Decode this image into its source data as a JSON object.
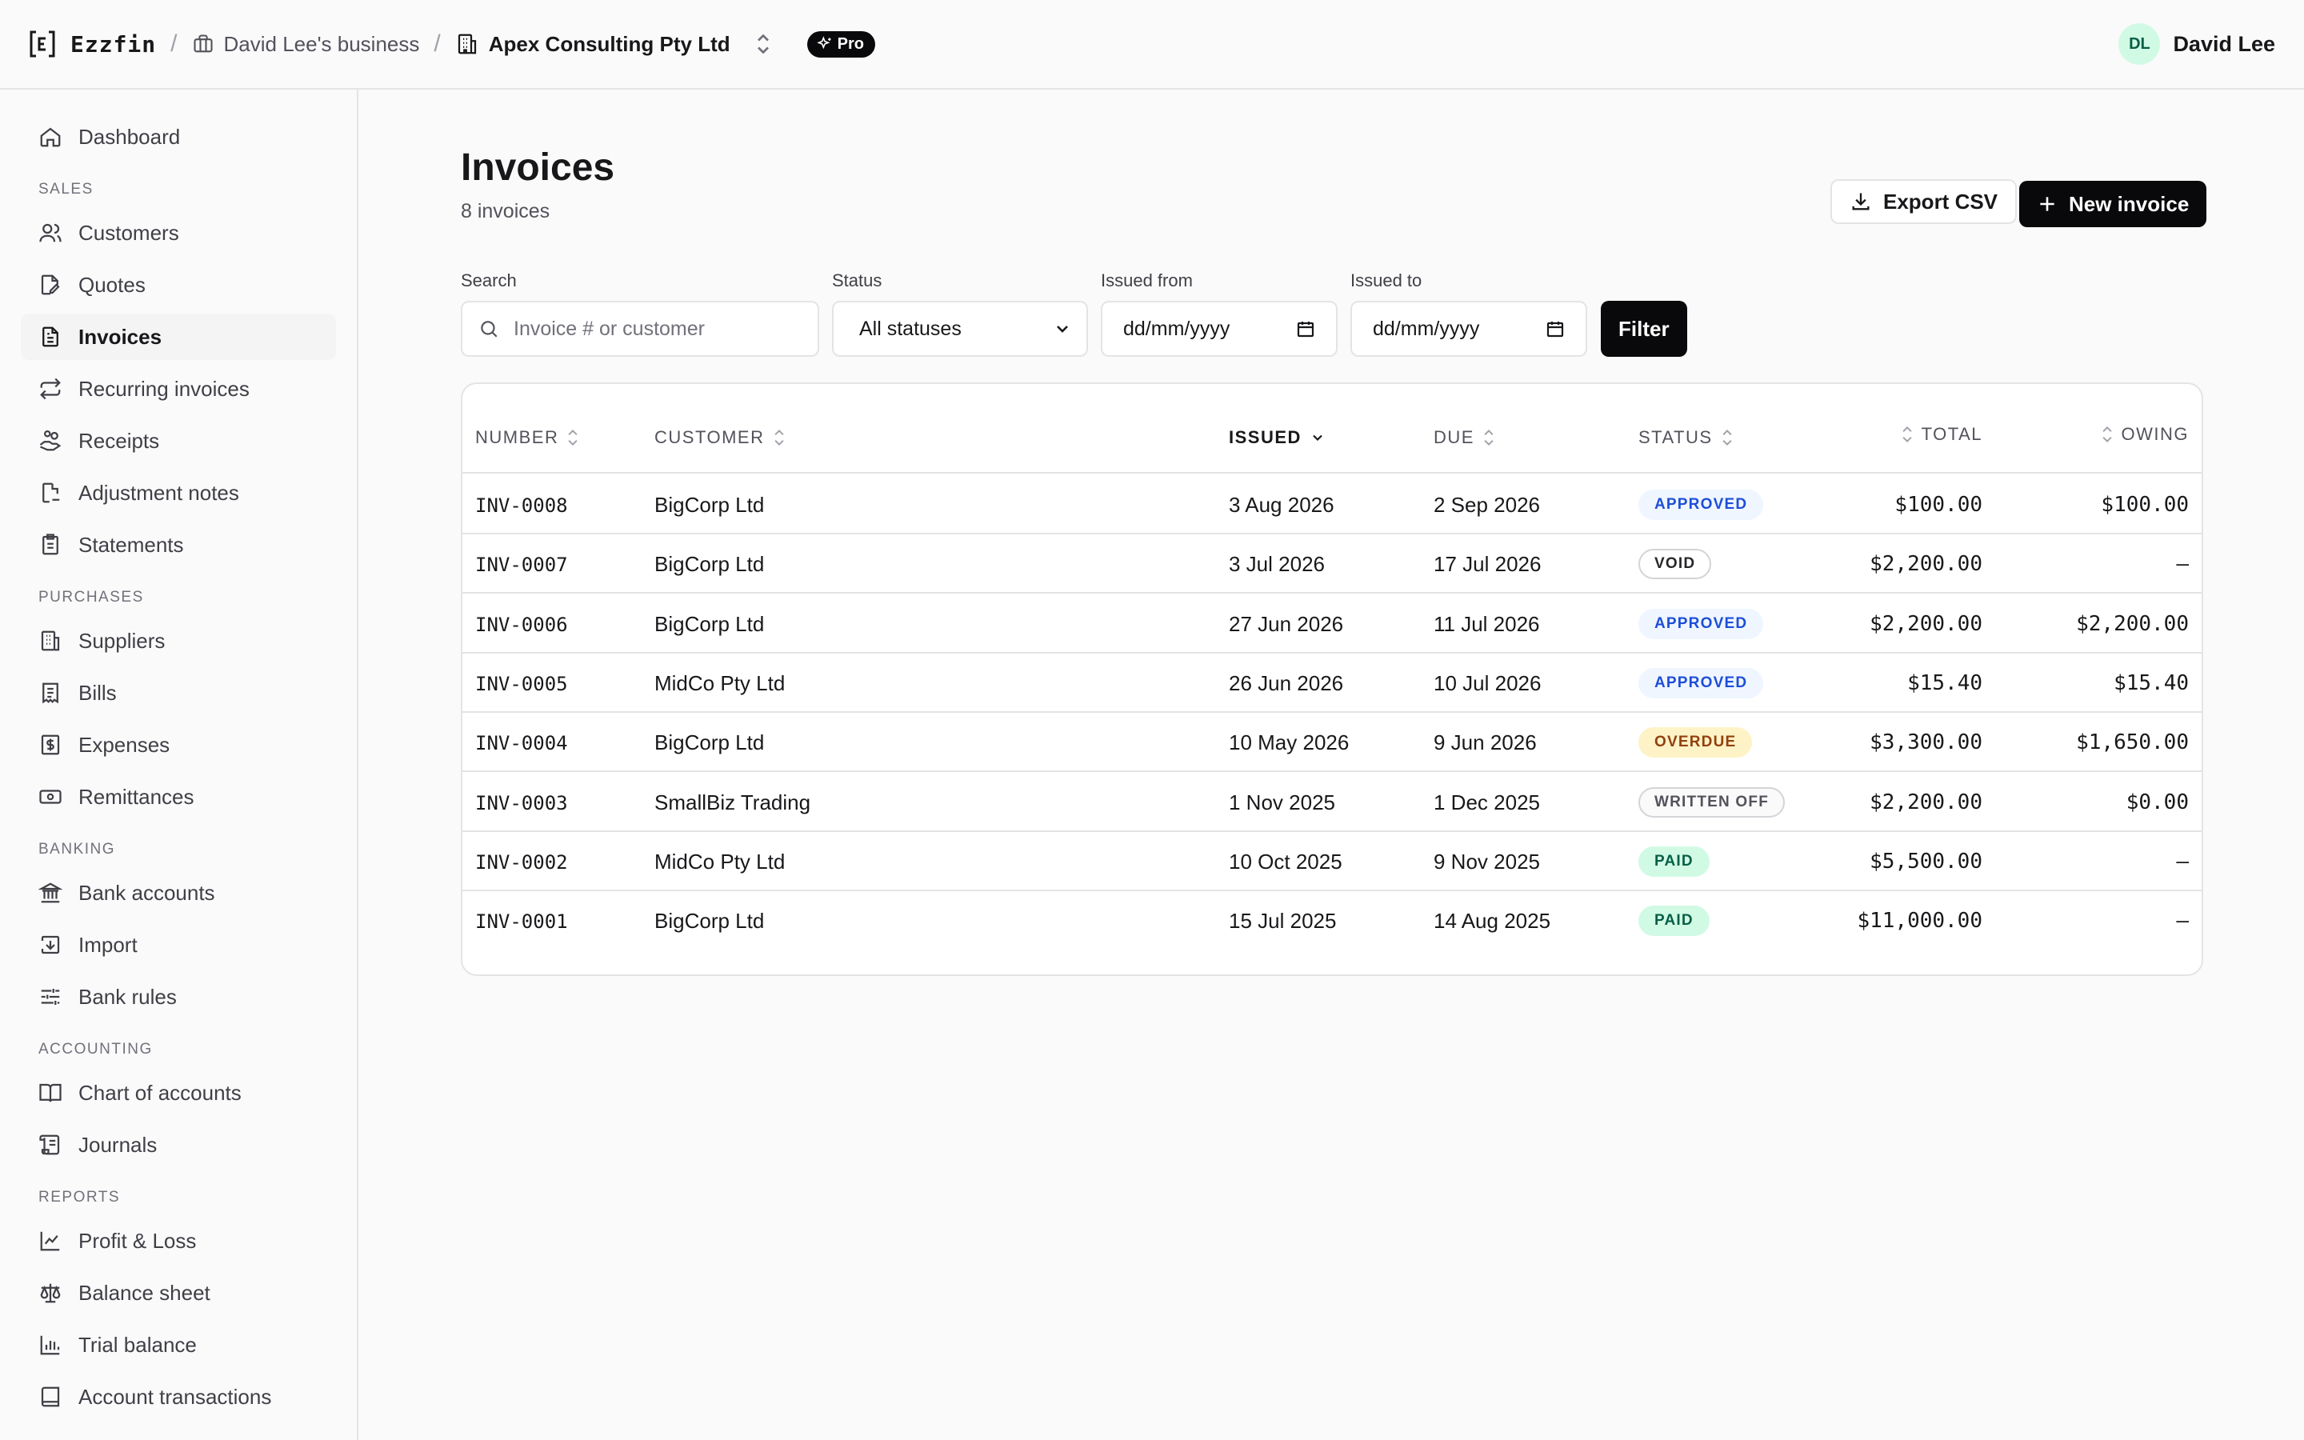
{
  "app": {
    "name": "Ezzfin"
  },
  "breadcrumb": {
    "business": "David Lee's business",
    "org": "Apex Consulting Pty Ltd",
    "plan": "Pro"
  },
  "user": {
    "initials": "DL",
    "name": "David Lee"
  },
  "sidebar": {
    "dashboard": "Dashboard",
    "sections": {
      "sales": "SALES",
      "purchases": "PURCHASES",
      "banking": "BANKING",
      "accounting": "ACCOUNTING",
      "reports": "REPORTS"
    },
    "sales": [
      "Customers",
      "Quotes",
      "Invoices",
      "Recurring invoices",
      "Receipts",
      "Adjustment notes",
      "Statements"
    ],
    "purchases": [
      "Suppliers",
      "Bills",
      "Expenses",
      "Remittances"
    ],
    "banking": [
      "Bank accounts",
      "Import",
      "Bank rules"
    ],
    "accounting": [
      "Chart of accounts",
      "Journals"
    ],
    "reports": [
      "Profit & Loss",
      "Balance sheet",
      "Trial balance",
      "Account transactions"
    ]
  },
  "page": {
    "title": "Invoices",
    "subtitle": "8 invoices",
    "export_label": "Export CSV",
    "new_label": "New invoice"
  },
  "filters": {
    "search_label": "Search",
    "search_placeholder": "Invoice # or customer",
    "status_label": "Status",
    "status_value": "All statuses",
    "from_label": "Issued from",
    "from_value": "dd/mm/yyyy",
    "to_label": "Issued to",
    "to_value": "dd/mm/yyyy",
    "filter_label": "Filter"
  },
  "table": {
    "headers": {
      "number": "NUMBER",
      "customer": "CUSTOMER",
      "issued": "ISSUED",
      "due": "DUE",
      "status": "STATUS",
      "total": "TOTAL",
      "owing": "OWING"
    },
    "rows": [
      {
        "number": "INV-0008",
        "customer": "BigCorp Ltd",
        "issued": "3 Aug 2026",
        "due": "2 Sep 2026",
        "status": "APPROVED",
        "total": "$100.00",
        "owing": "$100.00"
      },
      {
        "number": "INV-0007",
        "customer": "BigCorp Ltd",
        "issued": "3 Jul 2026",
        "due": "17 Jul 2026",
        "status": "VOID",
        "total": "$2,200.00",
        "owing": "–"
      },
      {
        "number": "INV-0006",
        "customer": "BigCorp Ltd",
        "issued": "27 Jun 2026",
        "due": "11 Jul 2026",
        "status": "APPROVED",
        "total": "$2,200.00",
        "owing": "$2,200.00"
      },
      {
        "number": "INV-0005",
        "customer": "MidCo Pty Ltd",
        "issued": "26 Jun 2026",
        "due": "10 Jul 2026",
        "status": "APPROVED",
        "total": "$15.40",
        "owing": "$15.40"
      },
      {
        "number": "INV-0004",
        "customer": "BigCorp Ltd",
        "issued": "10 May 2026",
        "due": "9 Jun 2026",
        "status": "OVERDUE",
        "total": "$3,300.00",
        "owing": "$1,650.00"
      },
      {
        "number": "INV-0003",
        "customer": "SmallBiz Trading",
        "issued": "1 Nov 2025",
        "due": "1 Dec 2025",
        "status": "WRITTEN OFF",
        "total": "$2,200.00",
        "owing": "$0.00"
      },
      {
        "number": "INV-0002",
        "customer": "MidCo Pty Ltd",
        "issued": "10 Oct 2025",
        "due": "9 Nov 2025",
        "status": "PAID",
        "total": "$5,500.00",
        "owing": "–"
      },
      {
        "number": "INV-0001",
        "customer": "BigCorp Ltd",
        "issued": "15 Jul 2025",
        "due": "14 Aug 2025",
        "status": "PAID",
        "total": "$11,000.00",
        "owing": "–"
      }
    ]
  },
  "status_colors": {
    "APPROVED": {
      "bg": "#eff6ff",
      "fg": "#1d4ed8",
      "border": "#eff6ff"
    },
    "VOID": {
      "bg": "#ffffff",
      "fg": "#27272a",
      "border": "#d4d4d8"
    },
    "OVERDUE": {
      "bg": "#fef3c7",
      "fg": "#92400e",
      "border": "#fef3c7"
    },
    "WRITTEN OFF": {
      "bg": "#fafafa",
      "fg": "#52525b",
      "border": "#d4d4d8"
    },
    "PAID": {
      "bg": "#d1fae5",
      "fg": "#065f46",
      "border": "#d1fae5"
    }
  }
}
